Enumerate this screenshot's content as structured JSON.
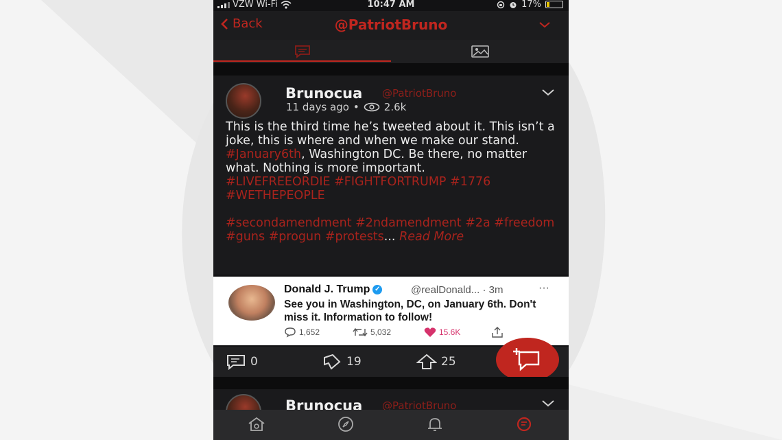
{
  "status_bar": {
    "carrier": "VZW Wi-Fi",
    "time": "10:47 AM",
    "battery": "17%"
  },
  "nav": {
    "back_label": "Back",
    "title": "@PatriotBruno"
  },
  "post": {
    "username": "Brunocua",
    "handle": "@PatriotBruno",
    "time_ago": "11 days ago",
    "separator": "•",
    "views": "2.6k",
    "text_part1": "This is the third time he’s tweeted about it. This isn’t a joke, this is where and when we make our stand. ",
    "hashtag_jan6": "#January6th",
    "text_part2": ", Washington DC. Be there, no matter what. Nothing is more important.",
    "hashtags_line1": "#LIVEFREEORDIE #FIGHTFORTRUMP #1776 #WETHEPEOPLE",
    "hashtags_line2": "#secondamendment #2ndamendment #2a #freedom #guns #progun #protests",
    "ellipsis": "...",
    "read_more": "Read More"
  },
  "embedded_tweet": {
    "name": "Donald J. Trump",
    "handle": "@realDonald...",
    "dot": "·",
    "time": "3m",
    "more": "···",
    "text": "See you in Washington, DC, on January 6th. Don't miss it. Information to follow!",
    "replies": "1,652",
    "retweets": "5,032",
    "likes": "15.6K"
  },
  "actions": {
    "comments": "0",
    "downvotes": "19",
    "upvotes": "25"
  },
  "next_post": {
    "username": "Brunocua",
    "handle": "@PatriotBruno"
  },
  "colors": {
    "accent": "#c0261f",
    "background": "#121214",
    "like": "#d6336c",
    "verified": "#1d9bf0"
  },
  "icons": [
    "wifi-icon",
    "lock-rotation-icon",
    "alarm-icon",
    "chat-tab-icon",
    "image-tab-icon",
    "eye-icon",
    "comment-icon",
    "downvote-icon",
    "upvote-icon",
    "compose-icon",
    "home-icon",
    "compass-icon",
    "bell-icon",
    "profile-icon"
  ]
}
